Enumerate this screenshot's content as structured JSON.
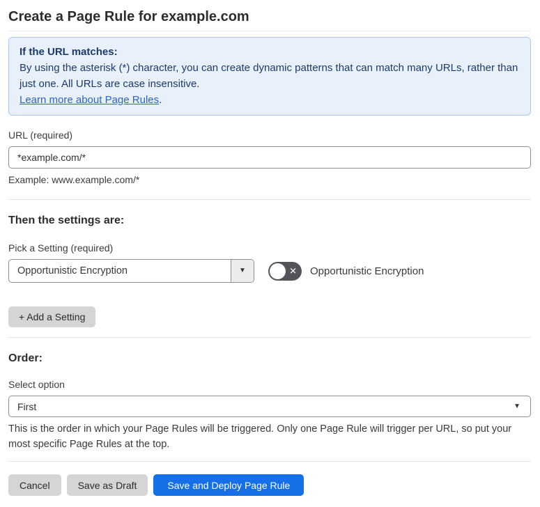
{
  "page": {
    "title": "Create a Page Rule for example.com"
  },
  "info_box": {
    "heading": "If the URL matches:",
    "body": "By using the asterisk (*) character, you can create dynamic patterns that can match many URLs, rather than just one. All URLs are case insensitive.",
    "link_label": "Learn more about Page Rules",
    "link_suffix": "."
  },
  "url_section": {
    "label": "URL (required)",
    "input_value": "*example.com/*",
    "helper": "Example: www.example.com/*"
  },
  "settings_section": {
    "heading": "Then the settings are:",
    "picker_label": "Pick a Setting (required)",
    "picker_value": "Opportunistic Encryption",
    "toggle_label": "Opportunistic Encryption",
    "toggle_state": "off",
    "add_setting_button": "+ Add a Setting"
  },
  "order_section": {
    "heading": "Order:",
    "select_label": "Select option",
    "select_value": "First",
    "helper": "This is the order in which your Page Rules will be triggered. Only one Page Rule will trigger per URL, so put your most specific Page Rules at the top."
  },
  "footer": {
    "cancel_label": "Cancel",
    "save_draft_label": "Save as Draft",
    "save_deploy_label": "Save and Deploy Page Rule"
  },
  "icons": {
    "dropdown_arrow": "▼",
    "select_arrow": "▼",
    "toggle_off_x": "✕"
  },
  "colors": {
    "primary_button_blue": "#1570e8",
    "info_box_background": "#e8f1fb",
    "info_box_border": "#abc9ef",
    "info_box_text": "#1b3a6b",
    "link_blue": "#2b62cc",
    "toggle_off_background": "#53545a",
    "gray_button_background": "#d5d5d5"
  }
}
